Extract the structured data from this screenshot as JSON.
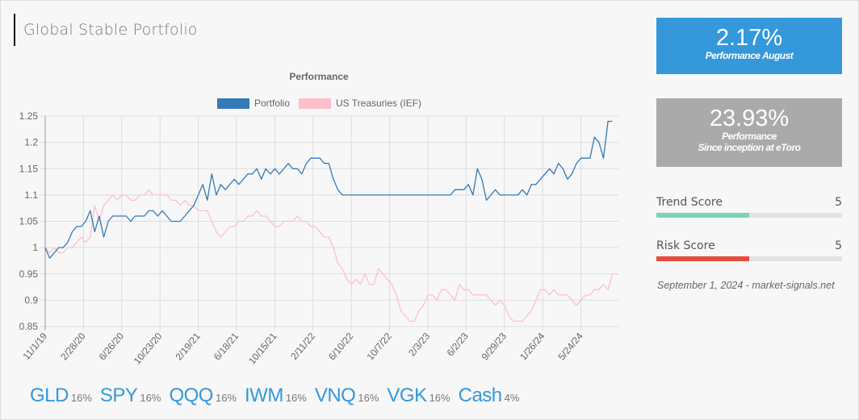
{
  "header": {
    "title": "Global Stable Portfolio"
  },
  "cards": {
    "monthly": {
      "value": "2.17%",
      "label": "Performance August",
      "color": "#3498db"
    },
    "inception": {
      "value": "23.93%",
      "label_line1": "Performance",
      "label_line2": "Since inception at eToro",
      "color": "#aaaaaa"
    }
  },
  "scores": [
    {
      "label": "Trend Score",
      "value": "5",
      "fraction": 0.5,
      "color": "#7dd3b5"
    },
    {
      "label": "Risk Score",
      "value": "5",
      "fraction": 0.5,
      "color": "#e74c3c"
    }
  ],
  "source": "September 1, 2024 - market-signals.net",
  "holdings": [
    {
      "ticker": "GLD",
      "weight": "16%"
    },
    {
      "ticker": "SPY",
      "weight": "16%"
    },
    {
      "ticker": "QQQ",
      "weight": "16%"
    },
    {
      "ticker": "IWM",
      "weight": "16%"
    },
    {
      "ticker": "VNQ",
      "weight": "16%"
    },
    {
      "ticker": "VGK",
      "weight": "16%"
    },
    {
      "ticker": "Cash",
      "weight": "4%"
    }
  ],
  "chart_data": {
    "type": "line",
    "title": "Performance",
    "xlabel": "",
    "ylabel": "",
    "ylim": [
      0.85,
      1.25
    ],
    "yticks": [
      "1.25",
      "1.2",
      "1.15",
      "1.1",
      "1.05",
      "1",
      "0.95",
      "0.9",
      "0.85"
    ],
    "ytick_values": [
      1.25,
      1.2,
      1.15,
      1.1,
      1.05,
      1.0,
      0.95,
      0.9,
      0.85
    ],
    "xticks": [
      "11/1/19",
      "2/28/20",
      "6/26/20",
      "10/23/20",
      "2/19/21",
      "6/18/21",
      "10/15/21",
      "2/11/22",
      "6/10/22",
      "10/7/22",
      "2/3/23",
      "6/2/23",
      "9/29/23",
      "1/26/24",
      "5/24/24"
    ],
    "x_unit": "weeks since 11/1/19 (each x tick = 17 weeks)",
    "grid": true,
    "legend": "top-center",
    "series": [
      {
        "name": "Portfolio",
        "color": "#337ab7",
        "step_weeks": 2,
        "values": [
          1.0,
          0.98,
          0.99,
          1.0,
          1.0,
          1.01,
          1.03,
          1.04,
          1.04,
          1.05,
          1.07,
          1.03,
          1.06,
          1.02,
          1.05,
          1.06,
          1.06,
          1.06,
          1.06,
          1.05,
          1.06,
          1.06,
          1.06,
          1.07,
          1.07,
          1.06,
          1.07,
          1.06,
          1.05,
          1.05,
          1.05,
          1.06,
          1.07,
          1.08,
          1.1,
          1.12,
          1.09,
          1.14,
          1.1,
          1.12,
          1.11,
          1.12,
          1.13,
          1.12,
          1.13,
          1.14,
          1.14,
          1.15,
          1.13,
          1.15,
          1.14,
          1.15,
          1.14,
          1.15,
          1.16,
          1.15,
          1.15,
          1.14,
          1.16,
          1.17,
          1.17,
          1.17,
          1.16,
          1.16,
          1.13,
          1.11,
          1.1,
          1.1,
          1.1,
          1.1,
          1.1,
          1.1,
          1.1,
          1.1,
          1.1,
          1.1,
          1.1,
          1.1,
          1.1,
          1.1,
          1.1,
          1.1,
          1.1,
          1.1,
          1.1,
          1.1,
          1.1,
          1.1,
          1.1,
          1.1,
          1.1,
          1.11,
          1.11,
          1.11,
          1.12,
          1.1,
          1.15,
          1.13,
          1.09,
          1.1,
          1.11,
          1.1,
          1.1,
          1.1,
          1.1,
          1.1,
          1.11,
          1.1,
          1.12,
          1.12,
          1.13,
          1.14,
          1.15,
          1.14,
          1.16,
          1.15,
          1.13,
          1.14,
          1.16,
          1.17,
          1.17,
          1.17,
          1.21,
          1.2,
          1.17,
          1.24,
          1.24
        ]
      },
      {
        "name": "US Treasuries (IEF)",
        "color": "#ffc0cb",
        "step_weeks": 2,
        "values": [
          1.0,
          0.99,
          1.0,
          0.99,
          0.99,
          1.0,
          1.0,
          1.01,
          1.02,
          1.01,
          1.02,
          1.08,
          1.05,
          1.08,
          1.09,
          1.1,
          1.09,
          1.1,
          1.1,
          1.09,
          1.09,
          1.1,
          1.1,
          1.11,
          1.1,
          1.1,
          1.1,
          1.1,
          1.09,
          1.09,
          1.08,
          1.09,
          1.08,
          1.08,
          1.07,
          1.07,
          1.07,
          1.05,
          1.03,
          1.02,
          1.03,
          1.04,
          1.04,
          1.05,
          1.05,
          1.06,
          1.06,
          1.07,
          1.06,
          1.06,
          1.05,
          1.04,
          1.04,
          1.05,
          1.05,
          1.05,
          1.06,
          1.05,
          1.05,
          1.04,
          1.04,
          1.03,
          1.02,
          1.02,
          1.0,
          0.97,
          0.96,
          0.94,
          0.93,
          0.94,
          0.93,
          0.95,
          0.93,
          0.93,
          0.96,
          0.95,
          0.94,
          0.93,
          0.91,
          0.88,
          0.87,
          0.86,
          0.86,
          0.88,
          0.89,
          0.91,
          0.91,
          0.9,
          0.92,
          0.92,
          0.91,
          0.9,
          0.93,
          0.92,
          0.92,
          0.91,
          0.91,
          0.91,
          0.91,
          0.9,
          0.89,
          0.9,
          0.89,
          0.87,
          0.86,
          0.86,
          0.86,
          0.87,
          0.88,
          0.9,
          0.92,
          0.92,
          0.91,
          0.92,
          0.91,
          0.91,
          0.91,
          0.9,
          0.89,
          0.9,
          0.91,
          0.91,
          0.92,
          0.92,
          0.93,
          0.92,
          0.95,
          0.95,
          0.95
        ]
      }
    ]
  }
}
